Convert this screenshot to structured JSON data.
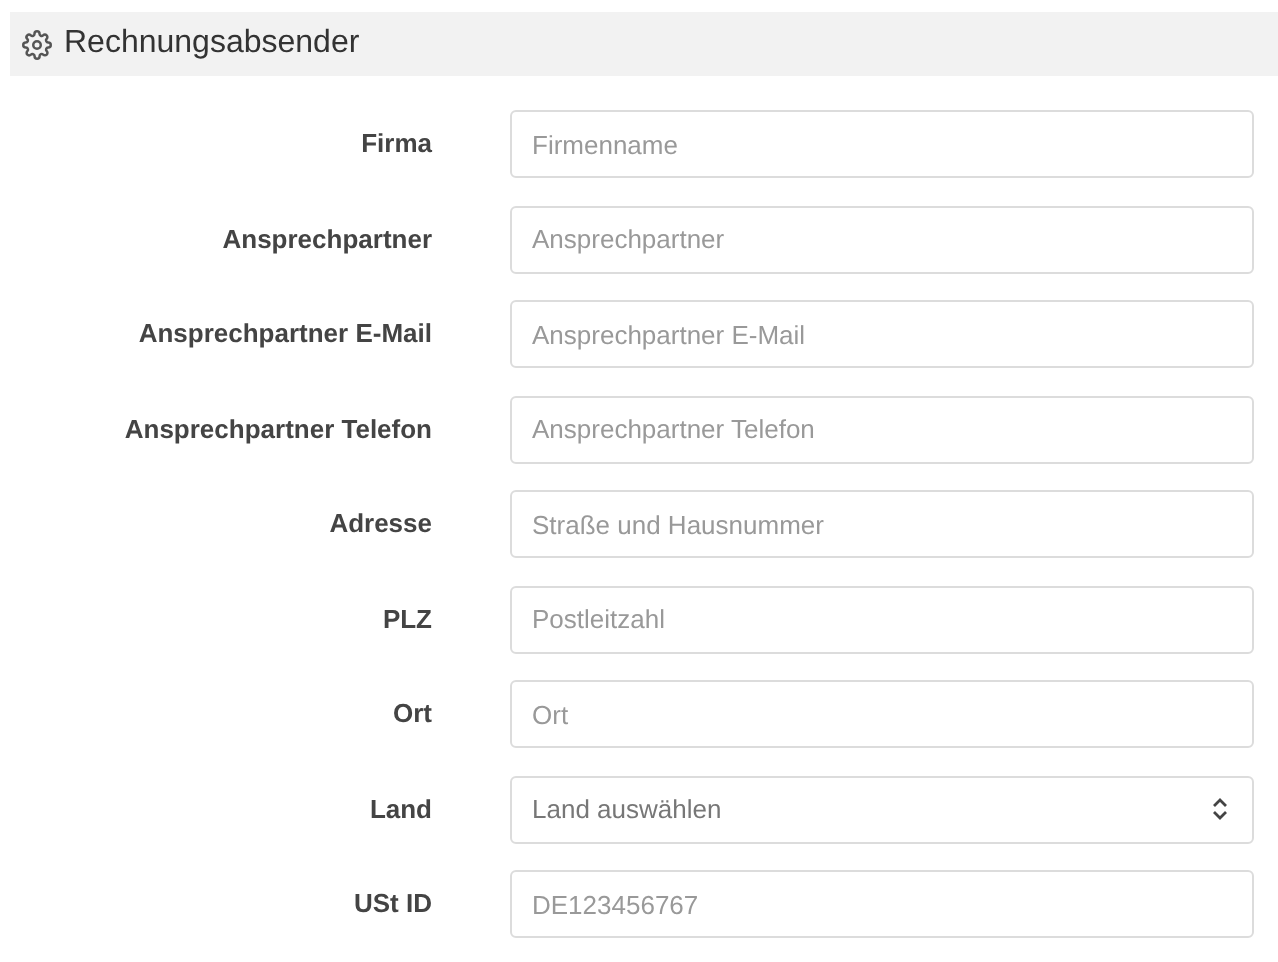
{
  "section": {
    "title": "Rechnungsabsender"
  },
  "fields": [
    {
      "label": "Firma",
      "kind": "text",
      "placeholder": "Firmenname"
    },
    {
      "label": "Ansprechpartner",
      "kind": "text",
      "placeholder": "Ansprechpartner"
    },
    {
      "label": "Ansprechpartner E-Mail",
      "kind": "text",
      "placeholder": "Ansprechpartner E-Mail"
    },
    {
      "label": "Ansprechpartner Telefon",
      "kind": "text",
      "placeholder": "Ansprechpartner Telefon"
    },
    {
      "label": "Adresse",
      "kind": "text",
      "placeholder": "Straße und Hausnummer"
    },
    {
      "label": "PLZ",
      "kind": "text",
      "placeholder": "Postleitzahl"
    },
    {
      "label": "Ort",
      "kind": "text",
      "placeholder": "Ort"
    },
    {
      "label": "Land",
      "kind": "select",
      "value": "Land auswählen"
    },
    {
      "label": "USt ID",
      "kind": "text",
      "placeholder": "DE123456767"
    }
  ]
}
